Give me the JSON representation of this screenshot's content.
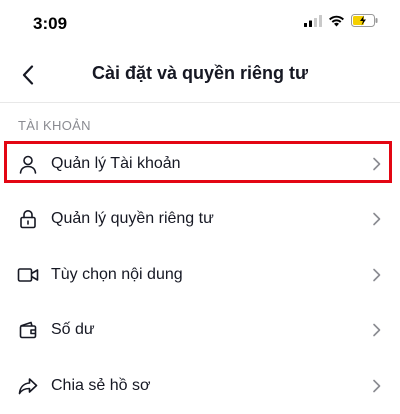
{
  "status_bar": {
    "time": "3:09"
  },
  "header": {
    "title": "Cài đặt và quyền riêng tư"
  },
  "section": {
    "title": "TÀI KHOẢN"
  },
  "menu": {
    "items": [
      {
        "label": "Quản lý Tài khoản",
        "icon": "user-icon"
      },
      {
        "label": "Quản lý quyền riêng tư",
        "icon": "lock-icon"
      },
      {
        "label": "Tùy chọn nội dung",
        "icon": "video-camera-icon"
      },
      {
        "label": "Số dư",
        "icon": "wallet-icon"
      },
      {
        "label": "Chia sẻ hồ sơ",
        "icon": "share-icon"
      }
    ]
  },
  "colors": {
    "highlight": "#e30613",
    "text": "#161823",
    "muted": "#8a8b91",
    "battery": "#f5d000"
  }
}
